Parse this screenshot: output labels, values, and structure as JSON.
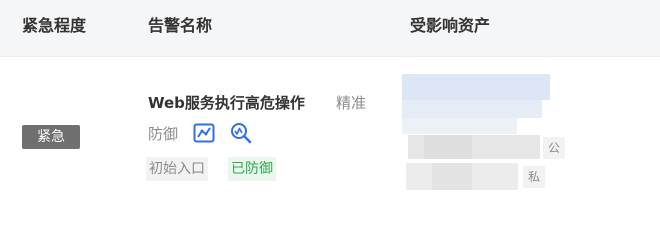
{
  "table": {
    "headers": {
      "level": "紧急程度",
      "name": "告警名称",
      "asset": "受影响资产"
    },
    "row": {
      "level": "紧急",
      "alert_name": "Web服务执行高危操作",
      "precision": "精准",
      "alert_type": "防御",
      "icons": [
        "chart-icon",
        "search-analysis-icon"
      ],
      "tags": {
        "entry": "初始入口",
        "status": "已防御"
      },
      "asset": {
        "public_label": "公",
        "private_label": "私"
      }
    }
  },
  "colors": {
    "header_bg": "#f5f6f8",
    "badge_bg": "#6f6f6f",
    "icon_blue": "#2f6fe0",
    "defended_green": "#2fa84f"
  }
}
